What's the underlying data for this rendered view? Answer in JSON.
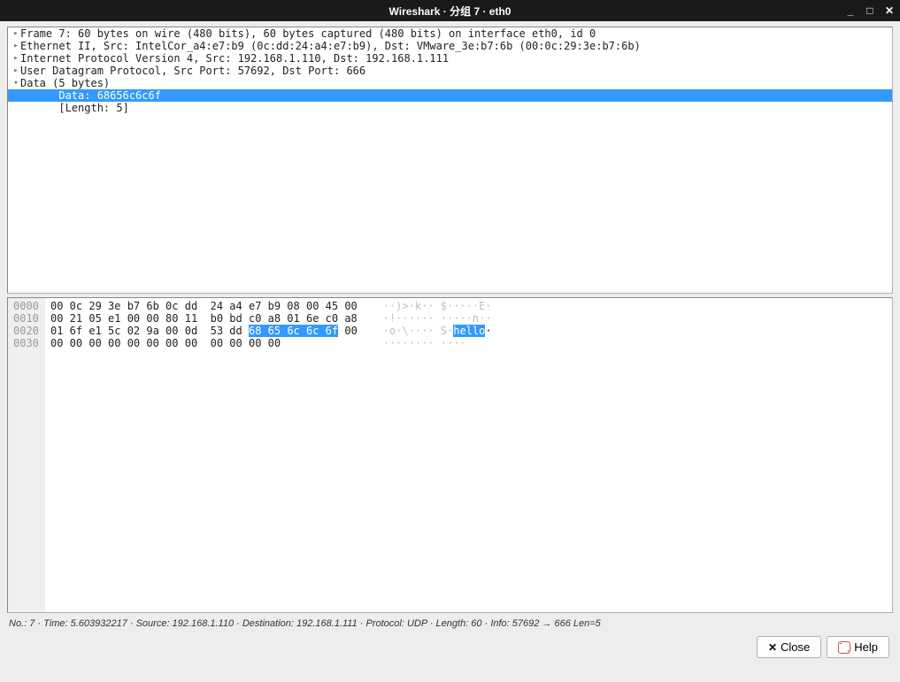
{
  "title": "Wireshark · 分组 7 · eth0",
  "tree": {
    "rows": [
      {
        "arrow": "▸",
        "indent": 0,
        "selected": false,
        "text": "Frame 7: 60 bytes on wire (480 bits), 60 bytes captured (480 bits) on interface eth0, id 0"
      },
      {
        "arrow": "▸",
        "indent": 0,
        "selected": false,
        "text": "Ethernet II, Src: IntelCor_a4:e7:b9 (0c:dd:24:a4:e7:b9), Dst: VMware_3e:b7:6b (00:0c:29:3e:b7:6b)"
      },
      {
        "arrow": "▸",
        "indent": 0,
        "selected": false,
        "text": "Internet Protocol Version 4, Src: 192.168.1.110, Dst: 192.168.1.111"
      },
      {
        "arrow": "▸",
        "indent": 0,
        "selected": false,
        "text": "User Datagram Protocol, Src Port: 57692, Dst Port: 666"
      },
      {
        "arrow": "▾",
        "indent": 0,
        "selected": false,
        "text": "Data (5 bytes)"
      },
      {
        "arrow": "",
        "indent": 2,
        "selected": true,
        "text": "Data: 68656c6c6f"
      },
      {
        "arrow": "",
        "indent": 2,
        "selected": false,
        "text": "[Length: 5]"
      }
    ]
  },
  "hex": {
    "offsets": [
      "0000",
      "0010",
      "0020",
      "0030"
    ],
    "hexlines": [
      {
        "pre": "00 0c 29 3e b7 6b 0c dd  24 a4 e7 b9 08 00 45 00",
        "hl": "",
        "post": ""
      },
      {
        "pre": "00 21 05 e1 00 00 80 11  b0 bd c0 a8 01 6e c0 a8",
        "hl": "",
        "post": ""
      },
      {
        "pre": "01 6f e1 5c 02 9a 00 0d  53 dd ",
        "hl": "68 65 6c 6c 6f",
        "post": " 00"
      },
      {
        "pre": "00 00 00 00 00 00 00 00  00 00 00 00",
        "hl": "",
        "post": ""
      }
    ],
    "asciilines": [
      {
        "pre": "··)>·k·· $·····E·",
        "hl": "",
        "post": ""
      },
      {
        "pre": "·!······ ·····n··",
        "hl": "",
        "post": ""
      },
      {
        "pre": "·o·\\···· S·",
        "hl": "hello",
        "post": "·"
      },
      {
        "pre": "········ ····",
        "hl": "",
        "post": ""
      }
    ]
  },
  "status": "No.: 7 · Time: 5.603932217 · Source: 192.168.1.110 · Destination: 192.168.1.111 · Protocol: UDP · Length: 60 · Info: 57692 → 666 Len=5",
  "buttons": {
    "close": "Close",
    "help": "Help"
  }
}
